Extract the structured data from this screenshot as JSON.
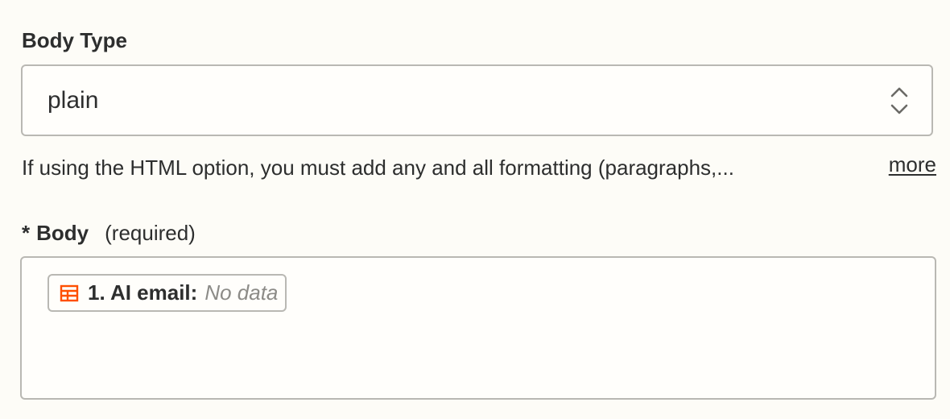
{
  "body_type": {
    "label": "Body Type",
    "selected_value": "plain",
    "arrows_icon": "chevron-up-down-icon",
    "help_text": "If using the HTML option, you must add any and all formatting (paragraphs,...",
    "more_link": "more"
  },
  "body": {
    "required_marker": "*",
    "label": "Body",
    "required_note": "(required)",
    "mapped_field": {
      "icon": "table-icon",
      "icon_color": "#ff4f00",
      "label": "1. AI email:",
      "value": "No data"
    }
  },
  "colors": {
    "background": "#fdfcf7",
    "border": "#b9b8b3",
    "text": "#2d2e2e",
    "placeholder": "#8c8b87",
    "accent": "#ff4f00"
  }
}
